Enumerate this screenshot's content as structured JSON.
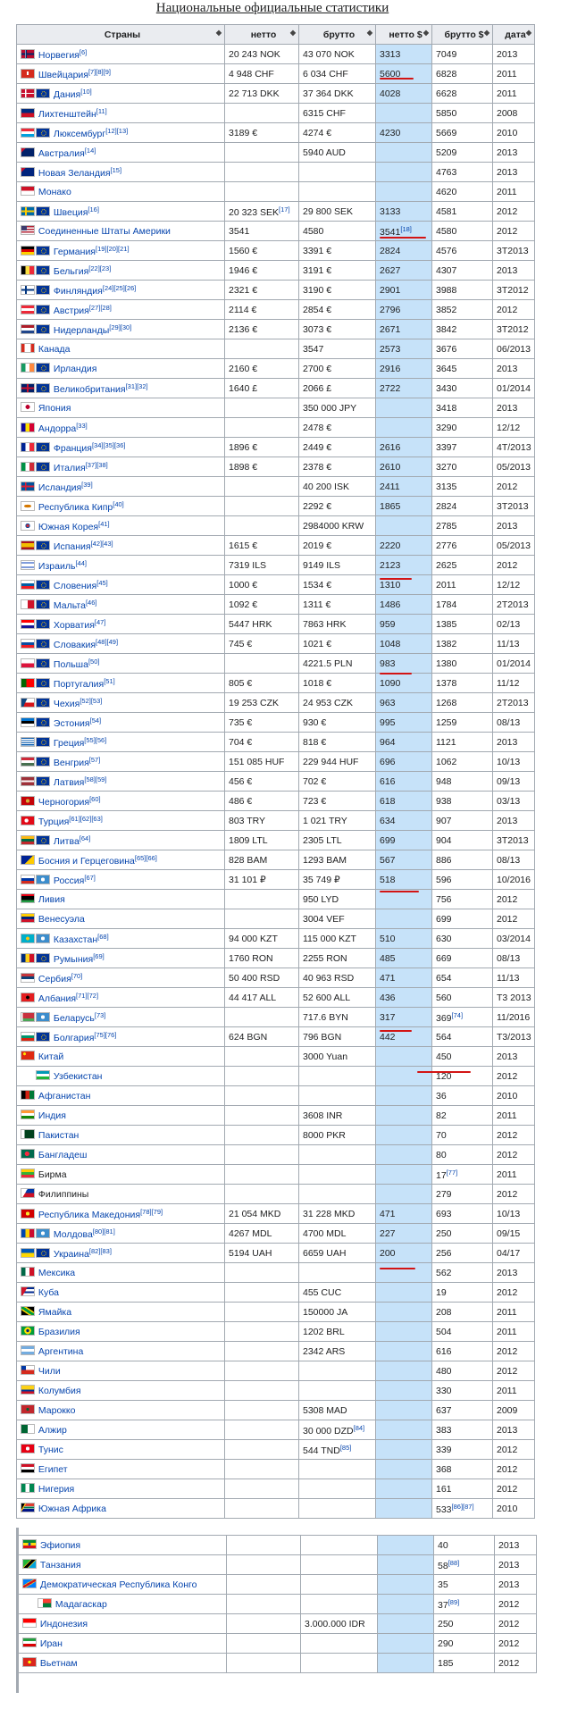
{
  "caption": "Национальные официальные статистики",
  "headers": [
    "Страны",
    "нетто",
    "брутто",
    "нетто $",
    "брутто $",
    "дата"
  ],
  "sort_icon": "sort-arrows-icon",
  "colors": {
    "link": "#0645ad",
    "netto_usd_bg": "#c6e2f9",
    "header_bg": "#eaecf0",
    "underline": "#d31414"
  },
  "rows": [
    {
      "flags": [
        "no"
      ],
      "name": "Норвегия",
      "ref": "[6]",
      "netto": "20 243 NOK",
      "brutto": "43 070 NOK",
      "netto_usd": "3313",
      "brutto_usd": "7049",
      "date": "2013"
    },
    {
      "flags": [
        "ch"
      ],
      "name": "Швейцария",
      "ref": "[7][8][9]",
      "netto": "4 948 CHF",
      "brutto": "6 034 CHF",
      "netto_usd": "5600",
      "brutto_usd": "6828",
      "date": "2011"
    },
    {
      "flags": [
        "dk",
        "eu"
      ],
      "name": "Дания",
      "ref": "[10]",
      "netto": "22 713 DKK",
      "brutto": "37 364 DKK",
      "netto_usd": "4028",
      "brutto_usd": "6628",
      "date": "2011"
    },
    {
      "flags": [
        "li"
      ],
      "name": "Лихтенштейн",
      "ref": "[11]",
      "netto": "",
      "brutto": "6315 CHF",
      "netto_usd": "",
      "brutto_usd": "5850",
      "date": "2008"
    },
    {
      "flags": [
        "lu",
        "eu"
      ],
      "name": "Люксембург",
      "ref": "[12][13]",
      "netto": "3189 €",
      "brutto": "4274 €",
      "netto_usd": "4230",
      "brutto_usd": "5669",
      "date": "2010"
    },
    {
      "flags": [
        "au"
      ],
      "name": "Австралия",
      "ref": "[14]",
      "netto": "",
      "brutto": "5940 AUD",
      "netto_usd": "",
      "brutto_usd": "5209",
      "date": "2013"
    },
    {
      "flags": [
        "nz"
      ],
      "name": "Новая Зеландия",
      "ref": "[15]",
      "netto": "",
      "brutto": "",
      "netto_usd": "",
      "brutto_usd": "4763",
      "date": "2013"
    },
    {
      "flags": [
        "mc"
      ],
      "name": "Монако",
      "ref": "",
      "netto": "",
      "brutto": "",
      "netto_usd": "",
      "brutto_usd": "4620",
      "date": "2011"
    },
    {
      "flags": [
        "se",
        "eu"
      ],
      "name": "Швеция",
      "ref": "[16]",
      "netto": "20 323 SEK",
      "netto_ref": "[17]",
      "brutto": "29 800 SEK",
      "netto_usd": "3133",
      "brutto_usd": "4581",
      "date": "2012"
    },
    {
      "flags": [
        "us"
      ],
      "name": "Соединенные Штаты Америки",
      "ref": "",
      "netto": "3541",
      "brutto": "4580",
      "netto_usd": "3541",
      "netto_usd_ref": "[18]",
      "brutto_usd": "4580",
      "date": "2012"
    },
    {
      "flags": [
        "de",
        "eu"
      ],
      "name": "Германия",
      "ref": "[19][20][21]",
      "netto": "1560 €",
      "brutto": "3391 €",
      "netto_usd": "2824",
      "brutto_usd": "4576",
      "date": "3Т2013"
    },
    {
      "flags": [
        "be",
        "eu"
      ],
      "name": "Бельгия",
      "ref": "[22][23]",
      "netto": "1946 €",
      "brutto": "3191 €",
      "netto_usd": "2627",
      "brutto_usd": "4307",
      "date": "2013"
    },
    {
      "flags": [
        "fi",
        "eu"
      ],
      "name": "Финляндия",
      "ref": "[24][25][26]",
      "netto": "2321 €",
      "brutto": "3190 €",
      "netto_usd": "2901",
      "brutto_usd": "3988",
      "date": "3Т2012"
    },
    {
      "flags": [
        "at",
        "eu"
      ],
      "name": "Австрия",
      "ref": "[27][28]",
      "netto": "2114 €",
      "brutto": "2854 €",
      "netto_usd": "2796",
      "brutto_usd": "3852",
      "date": "2012"
    },
    {
      "flags": [
        "nl",
        "eu"
      ],
      "name": "Нидерланды",
      "ref": "[29][30]",
      "netto": "2136 €",
      "brutto": "3073 €",
      "netto_usd": "2671",
      "brutto_usd": "3842",
      "date": "3Т2012"
    },
    {
      "flags": [
        "ca"
      ],
      "name": "Канада",
      "ref": "",
      "netto": "",
      "brutto": "3547",
      "netto_usd": "2573",
      "brutto_usd": "3676",
      "date": "06/2013"
    },
    {
      "flags": [
        "ie",
        "eu"
      ],
      "name": "Ирландия",
      "ref": "",
      "netto": "2160 €",
      "brutto": "2700 €",
      "netto_usd": "2916",
      "brutto_usd": "3645",
      "date": "2013"
    },
    {
      "flags": [
        "gb",
        "eu"
      ],
      "name": "Великобритания",
      "ref": "[31][32]",
      "netto": "1640 £",
      "brutto": "2066 £",
      "netto_usd": "2722",
      "brutto_usd": "3430",
      "date": "01/2014"
    },
    {
      "flags": [
        "jp"
      ],
      "name": "Япония",
      "ref": "",
      "netto": "",
      "brutto": "350 000 JPY",
      "netto_usd": "",
      "brutto_usd": "3418",
      "date": "2013"
    },
    {
      "flags": [
        "ad"
      ],
      "name": "Андорра",
      "ref": "[33]",
      "netto": "",
      "brutto": "2478 €",
      "netto_usd": "",
      "brutto_usd": "3290",
      "date": "12/12"
    },
    {
      "flags": [
        "fr",
        "eu"
      ],
      "name": "Франция",
      "ref": "[34][35][36]",
      "netto": "1896 €",
      "brutto": "2449 €",
      "netto_usd": "2616",
      "brutto_usd": "3397",
      "date": "4Т/2013"
    },
    {
      "flags": [
        "it",
        "eu"
      ],
      "name": "Италия",
      "ref": "[37][38]",
      "netto": "1898 €",
      "brutto": "2378 €",
      "netto_usd": "2610",
      "brutto_usd": "3270",
      "date": "05/2013"
    },
    {
      "flags": [
        "is"
      ],
      "name": "Исландия",
      "ref": "[39]",
      "netto": "",
      "brutto": "40 200 ISK",
      "netto_usd": "2411",
      "brutto_usd": "3135",
      "date": "2012"
    },
    {
      "flags": [
        "cy"
      ],
      "name": "Республика Кипр",
      "ref": "[40]",
      "netto": "",
      "brutto": "2292 €",
      "netto_usd": "1865",
      "brutto_usd": "2824",
      "date": "3Т2013"
    },
    {
      "flags": [
        "kr"
      ],
      "name": "Южная Корея",
      "ref": "[41]",
      "netto": "",
      "brutto": "2984000 KRW",
      "netto_usd": "",
      "brutto_usd": "2785",
      "date": "2013"
    },
    {
      "flags": [
        "es",
        "eu"
      ],
      "name": "Испания",
      "ref": "[42][43]",
      "netto": "1615 €",
      "brutto": "2019 €",
      "netto_usd": "2220",
      "brutto_usd": "2776",
      "date": "05/2013"
    },
    {
      "flags": [
        "il"
      ],
      "name": "Израиль",
      "ref": "[44]",
      "netto": "7319 ILS",
      "brutto": "9149 ILS",
      "netto_usd": "2123",
      "brutto_usd": "2625",
      "date": "2012"
    },
    {
      "flags": [
        "si",
        "eu"
      ],
      "name": "Словения",
      "ref": "[45]",
      "netto": "1000 €",
      "brutto": "1534 €",
      "netto_usd": "1310",
      "brutto_usd": "2011",
      "date": "12/12"
    },
    {
      "flags": [
        "mt",
        "eu"
      ],
      "name": "Мальта",
      "ref": "[46]",
      "netto": "1092 €",
      "brutto": "1311 €",
      "netto_usd": "1486",
      "brutto_usd": "1784",
      "date": "2Т2013"
    },
    {
      "flags": [
        "hr",
        "eu"
      ],
      "name": "Хорватия",
      "ref": "[47]",
      "netto": "5447 HRK",
      "brutto": "7863 HRK",
      "netto_usd": "959",
      "brutto_usd": "1385",
      "date": "02/13"
    },
    {
      "flags": [
        "sk",
        "eu"
      ],
      "name": "Словакия",
      "ref": "[48][49]",
      "netto": "745 €",
      "brutto": "1021 €",
      "netto_usd": "1048",
      "brutto_usd": "1382",
      "date": "11/13"
    },
    {
      "flags": [
        "pl",
        "eu"
      ],
      "name": "Польша",
      "ref": "[50]",
      "netto": "",
      "brutto": "4221.5 PLN",
      "netto_usd": "983",
      "brutto_usd": "1380",
      "date": "01/2014"
    },
    {
      "flags": [
        "pt",
        "eu"
      ],
      "name": "Португалия",
      "ref": "[51]",
      "netto": "805 €",
      "brutto": "1018 €",
      "netto_usd": "1090",
      "brutto_usd": "1378",
      "date": "11/12"
    },
    {
      "flags": [
        "cz",
        "eu"
      ],
      "name": "Чехия",
      "ref": "[52][53]",
      "netto": "19 253 CZK",
      "brutto": "24 953 CZK",
      "netto_usd": "963",
      "brutto_usd": "1268",
      "date": "2Т2013"
    },
    {
      "flags": [
        "ee",
        "eu"
      ],
      "name": "Эстония",
      "ref": "[54]",
      "netto": "735 €",
      "brutto": "930 €",
      "netto_usd": "995",
      "brutto_usd": "1259",
      "date": "08/13"
    },
    {
      "flags": [
        "gr",
        "eu"
      ],
      "name": "Греция",
      "ref": "[55][56]",
      "netto": "704 €",
      "brutto": "818 €",
      "netto_usd": "964",
      "brutto_usd": "1121",
      "date": "2013"
    },
    {
      "flags": [
        "hu",
        "eu"
      ],
      "name": "Венгрия",
      "ref": "[57]",
      "netto": "151 085 HUF",
      "brutto": "229 944 HUF",
      "netto_usd": "696",
      "brutto_usd": "1062",
      "date": "10/13"
    },
    {
      "flags": [
        "lv",
        "eu"
      ],
      "name": "Латвия",
      "ref": "[58][59]",
      "netto": "456 €",
      "brutto": "702 €",
      "netto_usd": "616",
      "brutto_usd": "948",
      "date": "09/13"
    },
    {
      "flags": [
        "me"
      ],
      "name": "Черногория",
      "ref": "[60]",
      "netto": "486 €",
      "brutto": "723 €",
      "netto_usd": "618",
      "brutto_usd": "938",
      "date": "03/13"
    },
    {
      "flags": [
        "tr"
      ],
      "name": "Турция",
      "ref": "[61][62][63]",
      "netto": "803 TRY",
      "brutto": "1 021 TRY",
      "netto_usd": "634",
      "brutto_usd": "907",
      "date": "2013"
    },
    {
      "flags": [
        "lt",
        "eu"
      ],
      "name": "Литва",
      "ref": "[64]",
      "netto": "1809 LTL",
      "brutto": "2305 LTL",
      "netto_usd": "699",
      "brutto_usd": "904",
      "date": "3Т2013"
    },
    {
      "flags": [
        "ba"
      ],
      "name": "Босния и Герцеговина",
      "ref": "[65][66]",
      "netto": "828 BAM",
      "brutto": "1293 BAM",
      "netto_usd": "567",
      "brutto_usd": "886",
      "date": "08/13"
    },
    {
      "flags": [
        "ru",
        "eaeu"
      ],
      "name": "Россия",
      "ref": "[67]",
      "netto": "31 101 ₽",
      "brutto": "35 749 ₽",
      "netto_usd": "518",
      "brutto_usd": "596",
      "date": "10/2016"
    },
    {
      "flags": [
        "ly"
      ],
      "name": "Ливия",
      "ref": "",
      "netto": "",
      "brutto": "950 LYD",
      "netto_usd": "",
      "brutto_usd": "756",
      "date": "2012"
    },
    {
      "flags": [
        "ve"
      ],
      "name": "Венесуэла",
      "ref": "",
      "netto": "",
      "brutto": "3004 VEF",
      "netto_usd": "",
      "brutto_usd": "699",
      "date": "2012"
    },
    {
      "flags": [
        "kz",
        "eaeu"
      ],
      "name": "Казахстан",
      "ref": "[68]",
      "netto": "94 000 KZT",
      "brutto": "115 000 KZT",
      "netto_usd": "510",
      "brutto_usd": "630",
      "date": "03/2014"
    },
    {
      "flags": [
        "ro",
        "eu"
      ],
      "name": "Румыния",
      "ref": "[69]",
      "netto": "1760 RON",
      "brutto": "2255 RON",
      "netto_usd": "485",
      "brutto_usd": "669",
      "date": "08/13"
    },
    {
      "flags": [
        "rs"
      ],
      "name": "Сербия",
      "ref": "[70]",
      "netto": "50 400 RSD",
      "brutto": "40 963 RSD",
      "netto_usd": "471",
      "brutto_usd": "654",
      "date": "11/13"
    },
    {
      "flags": [
        "al"
      ],
      "name": "Албания",
      "ref": "[71][72]",
      "netto": "44 417 ALL",
      "brutto": "52 600 ALL",
      "netto_usd": "436",
      "brutto_usd": "560",
      "date": "Т3 2013"
    },
    {
      "flags": [
        "by",
        "eaeu"
      ],
      "name": "Беларусь",
      "ref": "[73]",
      "netto": "",
      "brutto": "717.6 BYN",
      "netto_usd": "317",
      "brutto_usd": "369",
      "brutto_usd_ref": "[74]",
      "date": "11/2016"
    },
    {
      "flags": [
        "bg",
        "eu"
      ],
      "name": "Болгария",
      "ref": "[75][76]",
      "netto": "624 BGN",
      "brutto": "796 BGN",
      "netto_usd": "442",
      "brutto_usd": "564",
      "date": "Т3/2013"
    },
    {
      "flags": [
        "cn"
      ],
      "name": "Китай",
      "ref": "",
      "netto": "",
      "brutto": "3000 Yuan",
      "netto_usd": "",
      "brutto_usd": "450",
      "date": "2013"
    },
    {
      "flags": [
        "blank",
        "uz"
      ],
      "name": "Узбекистан",
      "ref": "",
      "netto": "",
      "brutto": "",
      "netto_usd": "",
      "brutto_usd": "120",
      "date": "2012"
    },
    {
      "flags": [
        "af"
      ],
      "name": "Афганистан",
      "ref": "",
      "netto": "",
      "brutto": "",
      "netto_usd": "",
      "brutto_usd": "36",
      "date": "2010"
    },
    {
      "flags": [
        "in"
      ],
      "name": "Индия",
      "ref": "",
      "netto": "",
      "brutto": "3608 INR",
      "netto_usd": "",
      "brutto_usd": "82",
      "date": "2011"
    },
    {
      "flags": [
        "pk"
      ],
      "name": "Пакистан",
      "ref": "",
      "netto": "",
      "brutto": "8000 PKR",
      "netto_usd": "",
      "brutto_usd": "70",
      "date": "2012"
    },
    {
      "flags": [
        "bd"
      ],
      "name": "Бангладеш",
      "ref": "",
      "netto": "",
      "brutto": "",
      "netto_usd": "",
      "brutto_usd": "80",
      "date": "2012"
    },
    {
      "flags": [
        "mm"
      ],
      "name": "Бирма",
      "ref": "",
      "plain": true,
      "netto": "",
      "brutto": "",
      "netto_usd": "",
      "brutto_usd": "17",
      "brutto_usd_ref": "[77]",
      "date": "2011"
    },
    {
      "flags": [
        "ph"
      ],
      "name": "Филиппины",
      "ref": "",
      "plain": true,
      "netto": "",
      "brutto": "",
      "netto_usd": "",
      "brutto_usd": "279",
      "date": "2012"
    },
    {
      "flags": [
        "mk"
      ],
      "name": "Республика Македония",
      "ref": "[78][79]",
      "netto": "21 054 MKD",
      "brutto": "31 228 MKD",
      "netto_usd": "471",
      "brutto_usd": "693",
      "date": "10/13"
    },
    {
      "flags": [
        "md",
        "eaeu"
      ],
      "name": "Молдова",
      "ref": "[80][81]",
      "netto": "4267 MDL",
      "brutto": "4700 MDL",
      "netto_usd": "227",
      "brutto_usd": "250",
      "date": "09/15"
    },
    {
      "flags": [
        "ua",
        "eu"
      ],
      "name": "Украина",
      "ref": "[82][83]",
      "netto": "5194 UAH",
      "brutto": "6659 UAH",
      "netto_usd": "200",
      "brutto_usd": "256",
      "date": "04/17"
    },
    {
      "flags": [
        "mx"
      ],
      "name": "Мексика",
      "ref": "",
      "netto": "",
      "brutto": "",
      "netto_usd": "",
      "brutto_usd": "562",
      "date": "2013"
    },
    {
      "flags": [
        "cu"
      ],
      "name": "Куба",
      "ref": "",
      "netto": "",
      "brutto": "455 CUC",
      "netto_usd": "",
      "brutto_usd": "19",
      "date": "2012"
    },
    {
      "flags": [
        "jm"
      ],
      "name": "Ямайка",
      "ref": "",
      "netto": "",
      "brutto": "150000 JA",
      "netto_usd": "",
      "brutto_usd": "208",
      "date": "2011"
    },
    {
      "flags": [
        "br"
      ],
      "name": "Бразилия",
      "ref": "",
      "netto": "",
      "brutto": "1202 BRL",
      "netto_usd": "",
      "brutto_usd": "504",
      "date": "2011"
    },
    {
      "flags": [
        "ar"
      ],
      "name": "Аргентина",
      "ref": "",
      "netto": "",
      "brutto": "2342 ARS",
      "netto_usd": "",
      "brutto_usd": "616",
      "date": "2012"
    },
    {
      "flags": [
        "cl"
      ],
      "name": "Чили",
      "ref": "",
      "netto": "",
      "brutto": "",
      "netto_usd": "",
      "brutto_usd": "480",
      "date": "2012"
    },
    {
      "flags": [
        "co"
      ],
      "name": "Колумбия",
      "ref": "",
      "netto": "",
      "brutto": "",
      "netto_usd": "",
      "brutto_usd": "330",
      "date": "2011"
    },
    {
      "flags": [
        "ma"
      ],
      "name": "Марокко",
      "ref": "",
      "netto": "",
      "brutto": "5308 MAD",
      "netto_usd": "",
      "brutto_usd": "637",
      "date": "2009"
    },
    {
      "flags": [
        "dz"
      ],
      "name": "Алжир",
      "ref": "",
      "netto": "",
      "brutto": "30 000 DZD",
      "brutto_ref": "[84]",
      "netto_usd": "",
      "brutto_usd": "383",
      "date": "2013"
    },
    {
      "flags": [
        "tn"
      ],
      "name": "Тунис",
      "ref": "",
      "netto": "",
      "brutto": "544 TND",
      "brutto_ref": "[85]",
      "netto_usd": "",
      "brutto_usd": "339",
      "date": "2012"
    },
    {
      "flags": [
        "eg"
      ],
      "name": "Египет",
      "ref": "",
      "netto": "",
      "brutto": "",
      "netto_usd": "",
      "brutto_usd": "368",
      "date": "2012"
    },
    {
      "flags": [
        "ng"
      ],
      "name": "Нигерия",
      "ref": "",
      "netto": "",
      "brutto": "",
      "netto_usd": "",
      "brutto_usd": "161",
      "date": "2012"
    },
    {
      "flags": [
        "za"
      ],
      "name": "Южная Африка",
      "ref": "",
      "netto": "",
      "brutto": "",
      "netto_usd": "",
      "brutto_usd": "533",
      "brutto_usd_ref": "[86][87]",
      "date": "2010"
    }
  ],
  "rows2": [
    {
      "flags": [
        "et"
      ],
      "name": "Эфиопия",
      "ref": "",
      "netto": "",
      "brutto": "",
      "netto_usd": "",
      "brutto_usd": "40",
      "date": "2013"
    },
    {
      "flags": [
        "tz"
      ],
      "name": "Танзания",
      "ref": "",
      "netto": "",
      "brutto": "",
      "netto_usd": "",
      "brutto_usd": "58",
      "brutto_usd_ref": "[88]",
      "date": "2013"
    },
    {
      "flags": [
        "cd"
      ],
      "name": "Демократическая Республика Конго",
      "ref": "",
      "netto": "",
      "brutto": "",
      "netto_usd": "",
      "brutto_usd": "35",
      "date": "2013"
    },
    {
      "flags": [
        "blank",
        "mg"
      ],
      "name": "Мадагаскар",
      "ref": "",
      "netto": "",
      "brutto": "",
      "netto_usd": "",
      "brutto_usd": "37",
      "brutto_usd_ref": "[89]",
      "date": "2012"
    },
    {
      "flags": [
        "id"
      ],
      "name": "Индонезия",
      "ref": "",
      "netto": "",
      "brutto": "3.000.000 IDR",
      "netto_usd": "",
      "brutto_usd": "250",
      "date": "2012"
    },
    {
      "flags": [
        "ir"
      ],
      "name": "Иран",
      "ref": "",
      "netto": "",
      "brutto": "",
      "netto_usd": "",
      "brutto_usd": "290",
      "date": "2012"
    },
    {
      "flags": [
        "vn"
      ],
      "name": "Вьетнам",
      "ref": "",
      "netto": "",
      "brutto": "",
      "netto_usd": "",
      "brutto_usd": "185",
      "date": "2012"
    }
  ]
}
